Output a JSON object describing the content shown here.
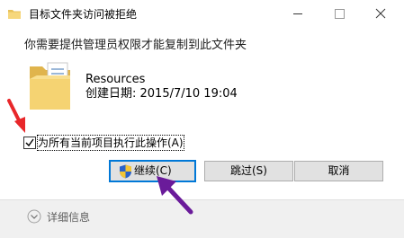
{
  "window": {
    "title": "目标文件夹访问被拒绝",
    "controls": [
      "minimize-icon",
      "maximize-icon",
      "close-icon"
    ]
  },
  "message": "你需要提供管理员权限才能复制到此文件夹",
  "file": {
    "name": "Resources",
    "date": "创建日期: 2015/7/10 19:04",
    "icon": "folder-icon"
  },
  "checkbox": {
    "label": "为所有当前项目执行此操作(A)",
    "checked": true
  },
  "buttons": {
    "continue": "继续(C)",
    "skip": "跳过(S)",
    "cancel": "取消"
  },
  "footer": {
    "details": "详细信息"
  },
  "colors": {
    "accent": "#0078d7",
    "red_arrow": "#e8272a",
    "purple_arrow": "#6a1b9a"
  }
}
